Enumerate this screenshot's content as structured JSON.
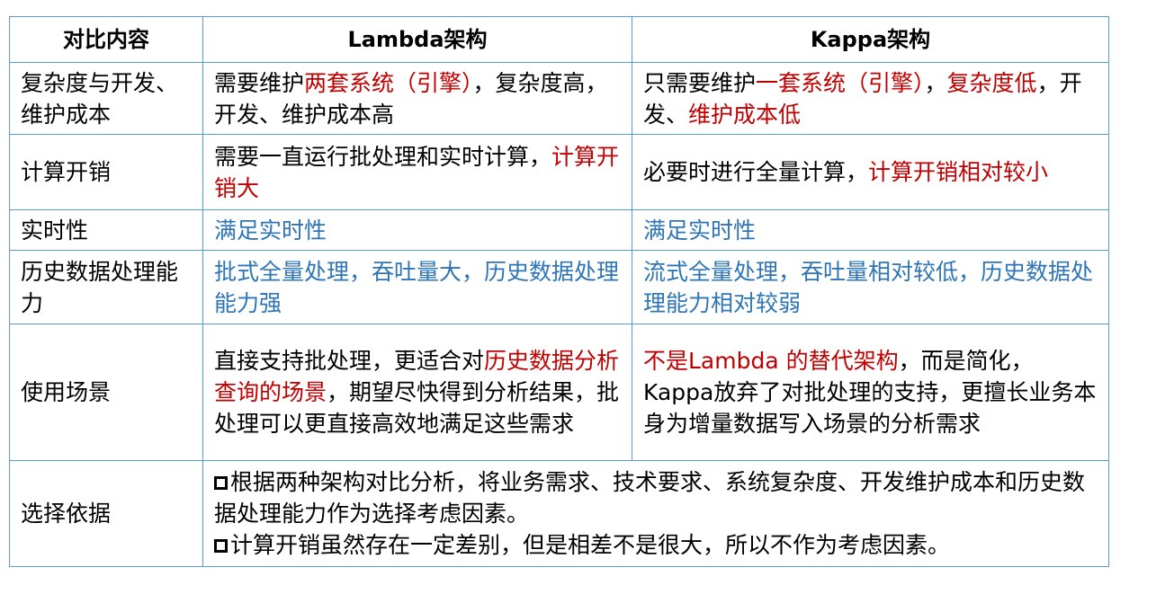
{
  "header": {
    "col_label": "对比内容",
    "col_lambda": "Lambda架构",
    "col_kappa": "Kappa架构"
  },
  "rows": [
    {
      "label": "复杂度与开发、维护成本",
      "lambda": [
        "需要维护",
        "两套系统（引擎）",
        "，复杂度高，开发、维护成本高"
      ],
      "kappa": [
        "只需要维护",
        "一套系统（引擎）",
        "，",
        "复杂度低",
        "，开发、",
        "维护成本低"
      ]
    },
    {
      "label": "计算开销",
      "lambda": [
        "需要一直运行批处理和实时计算，",
        "计算开销大"
      ],
      "kappa": [
        "必要时进行全量计算，",
        "计算开销相对较小"
      ]
    },
    {
      "label": "实时性",
      "lambda": [
        "满足实时性"
      ],
      "kappa": [
        "满足实时性"
      ]
    },
    {
      "label": "历史数据处理能力",
      "lambda": [
        "批式全量处理，吞吐量大，历史数据处理能力强"
      ],
      "kappa": [
        "流式全量处理，吞吐量相对较低，历史数据处理能力相对较弱"
      ]
    },
    {
      "label": "使用场景",
      "lambda": [
        "直接支持批处理，更适合对",
        "历史数据分析查询的场景",
        "，期望尽快得到分析结果，批处理可以更直接高效地满足这些需求"
      ],
      "kappa": [
        "不是Lambda 的替代架构",
        "，而是简化，Kappa放弃了对批处理的支持，更擅长业务本身为增量数据写入场景的分析需求"
      ]
    },
    {
      "label": "选择依据",
      "notes": [
        "根据两种架构对比分析，将业务需求、技术要求、系统复杂度、开发维护成本和历史数据处理能力作为选择考虑因素。",
        "计算开销虽然存在一定差别，但是相差不是很大，所以不作为考虑因素。"
      ]
    }
  ],
  "colors": {
    "border": "#5b9bd5",
    "highlight_red": "#c00000",
    "highlight_blue": "#2e75b6"
  }
}
